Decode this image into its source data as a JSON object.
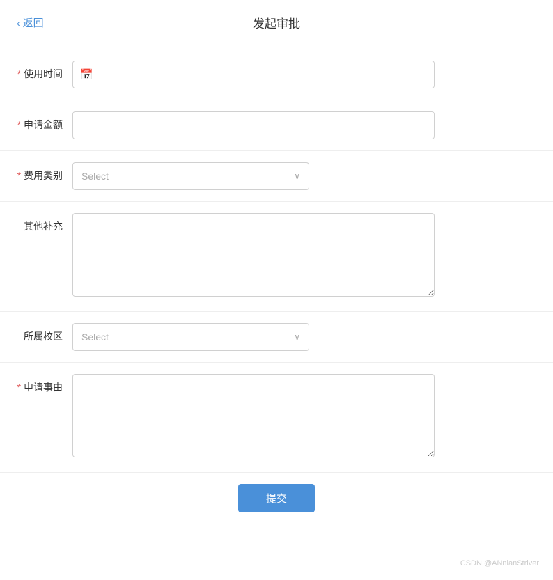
{
  "header": {
    "back_label": "返回",
    "title": "发起审批"
  },
  "form": {
    "fields": [
      {
        "id": "use_time",
        "label": "使用时间",
        "required": true,
        "type": "date",
        "placeholder": ""
      },
      {
        "id": "amount",
        "label": "申请金额",
        "required": true,
        "type": "text",
        "placeholder": ""
      },
      {
        "id": "expense_type",
        "label": "费用类别",
        "required": true,
        "type": "select",
        "placeholder": "Select"
      },
      {
        "id": "supplement",
        "label": "其他补充",
        "required": false,
        "type": "textarea",
        "placeholder": ""
      },
      {
        "id": "campus",
        "label": "所属校区",
        "required": false,
        "type": "select",
        "placeholder": "Select"
      },
      {
        "id": "reason",
        "label": "申请事由",
        "required": true,
        "type": "textarea",
        "placeholder": ""
      }
    ],
    "submit_label": "提交"
  },
  "icons": {
    "chevron_left": "‹",
    "calendar": "▦",
    "chevron_down": "∨"
  },
  "watermark": "CSDN @ANnianStriver"
}
